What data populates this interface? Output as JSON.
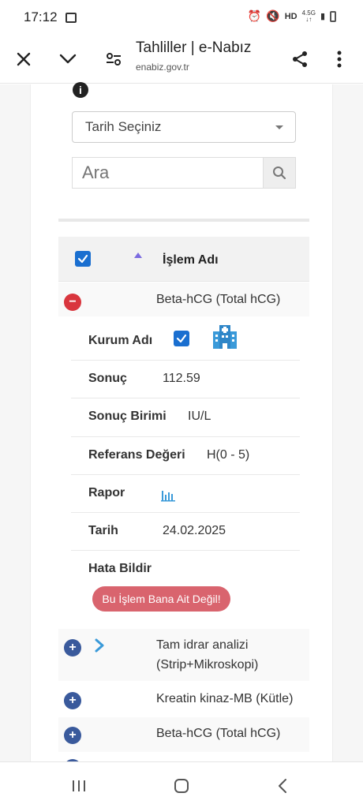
{
  "status_bar": {
    "time": "17:12",
    "network_top": "4.5G",
    "network_bottom": "↓↑"
  },
  "browser": {
    "title": "Tahliller | e-Nabız",
    "url": "enabiz.gov.tr"
  },
  "filters": {
    "date_select": "Tarih Seçiniz",
    "search_placeholder": "Ara"
  },
  "table": {
    "header_label": "İşlem Adı",
    "expanded_row": {
      "title": "Beta-hCG (Total hCG)",
      "details": {
        "kurum_label": "Kurum Adı",
        "sonuc_label": "Sonuç",
        "sonuc_value": "112.59",
        "birim_label": "Sonuç Birimi",
        "birim_value": "IU/L",
        "referans_label": "Referans Değeri",
        "referans_value": "H(0 - 5)",
        "rapor_label": "Rapor",
        "tarih_label": "Tarih",
        "tarih_value": "24.02.2025",
        "hata_label": "Hata Bildir",
        "hata_button": "Bu İşlem Bana Ait Değil!"
      }
    },
    "rows": [
      {
        "title_line1": "Tam idrar analizi",
        "title_line2": "(Strip+Mikroskopi)"
      },
      {
        "title": "Kreatin kinaz-MB (Kütle)"
      },
      {
        "title": "Beta-hCG (Total hCG)"
      }
    ]
  },
  "colors": {
    "accent_blue": "#1a6fd0",
    "minus_red": "#d9363e",
    "plus_navy": "#3a5a9c",
    "report_button": "#d9646e",
    "sort_arrow": "#7b6be0",
    "hospital_icon": "#3a9ad9"
  }
}
